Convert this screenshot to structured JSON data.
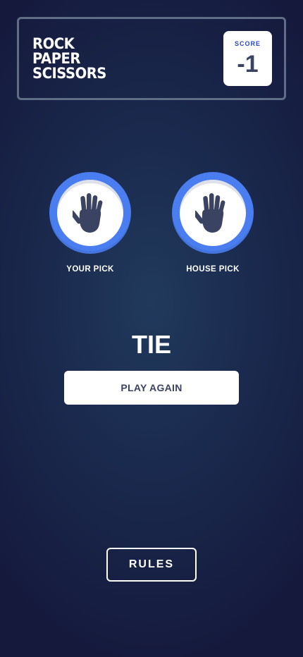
{
  "header": {
    "title_lines": [
      "ROCK",
      "PAPER",
      "SCISSORS"
    ],
    "score_label": "SCORE",
    "score_value": "-1"
  },
  "picks": {
    "your_pick": {
      "label": "YOUR PICK",
      "choice": "paper",
      "icon": "hand-paper-icon"
    },
    "house_pick": {
      "label": "HOUSE PICK",
      "choice": "paper",
      "icon": "hand-paper-icon"
    }
  },
  "result": {
    "text": "TIE",
    "play_again_label": "PLAY AGAIN"
  },
  "footer": {
    "rules_label": "RULES"
  },
  "colors": {
    "background_center": "#213a5c",
    "background_edge": "#151a3d",
    "header_border": "#5f6d85",
    "paper_ring": "#4a7ef0",
    "score_label": "#2a46c0",
    "dark_text": "#3b4363",
    "hand_icon": "#3b4363"
  }
}
